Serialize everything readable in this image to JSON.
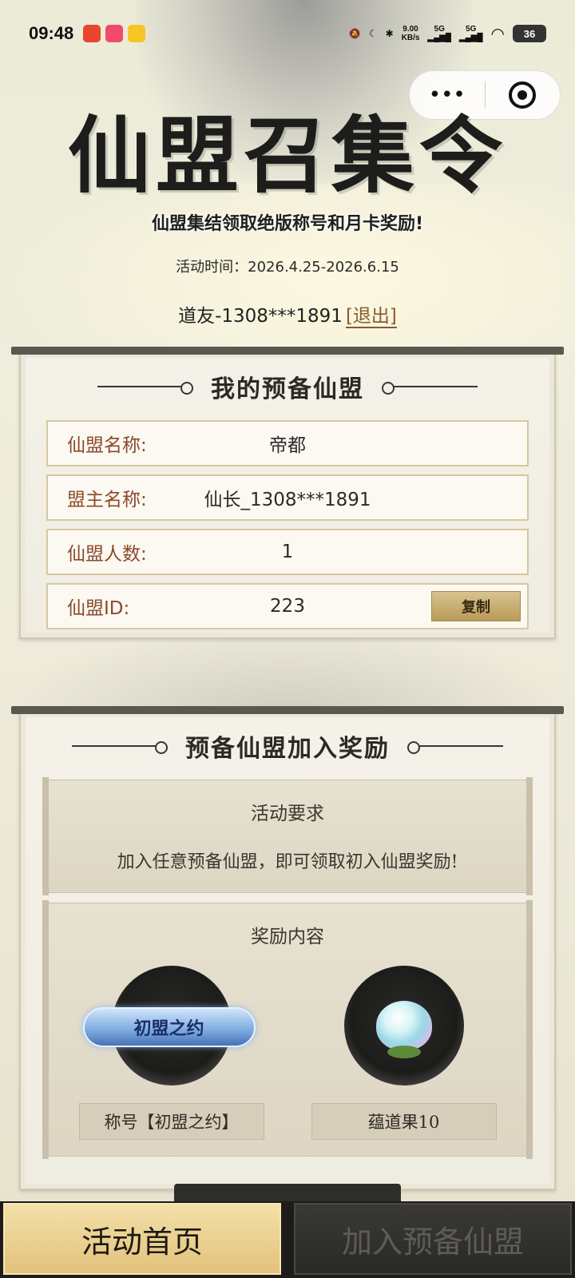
{
  "status_bar": {
    "time": "09:48",
    "net_speed": "9.00",
    "net_unit": "KB/s",
    "signal_1": "5G",
    "signal_2": "5G",
    "battery": "36",
    "icons": [
      "mute-icon",
      "moon-icon",
      "bluetooth-icon",
      "wifi-icon"
    ]
  },
  "capsule": {
    "more_glyph": "•••",
    "icons": [
      "more-icon",
      "close-target-icon"
    ]
  },
  "header": {
    "title": "仙盟召集令",
    "subtitle": "仙盟集结领取绝版称号和月卡奖励!",
    "activity_time": "活动时间：2026.4.25-2026.6.15",
    "user_label": "道友-1308***1891",
    "logout": "[退出]"
  },
  "my_alliance": {
    "title": "我的预备仙盟",
    "rows": [
      {
        "label": "仙盟名称:",
        "value": "帝都"
      },
      {
        "label": "盟主名称:",
        "value": "仙长_1308***1891"
      },
      {
        "label": "仙盟人数:",
        "value": "1"
      },
      {
        "label": "仙盟ID:",
        "value": "223"
      }
    ],
    "copy_button": "复制"
  },
  "rewards_panel": {
    "title": "预备仙盟加入奖励",
    "requirement_heading": "活动要求",
    "requirement_text": "加入任意预备仙盟，即可领取初入仙盟奖励!",
    "content_heading": "奖励内容",
    "items": [
      {
        "badge": "初盟之约",
        "name": "称号【初盟之约】"
      },
      {
        "name": "蕴道果10"
      }
    ]
  },
  "bottom_nav": {
    "home": "活动首页",
    "join": "加入预备仙盟"
  },
  "colors": {
    "accent_gold": "#e3c27c",
    "label_brown": "#8a4a2a",
    "dark_bar": "#1d1c1a"
  }
}
